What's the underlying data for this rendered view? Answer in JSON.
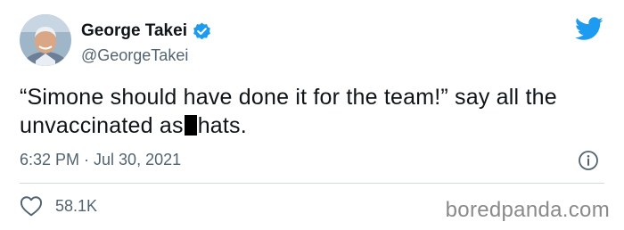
{
  "tweet": {
    "author": {
      "display_name": "George Takei",
      "handle": "@GeorgeTakei",
      "verified": true,
      "avatar_icon": "profile-photo"
    },
    "text_before_censor": "“Simone should have done it for the team!” say all the unvaccinated as",
    "text_after_censor": "hats.",
    "timestamp": "6:32 PM · Jul 30, 2021",
    "likes": "58.1K"
  },
  "icons": {
    "brand": "twitter-bird-icon",
    "verified": "verified-badge-icon",
    "info": "info-icon",
    "like": "heart-icon"
  },
  "colors": {
    "twitter_blue": "#1d9bf0",
    "text_primary": "#0f1419",
    "text_secondary": "#536471",
    "divider": "#cfd9de"
  },
  "watermark": "boredpanda.com"
}
